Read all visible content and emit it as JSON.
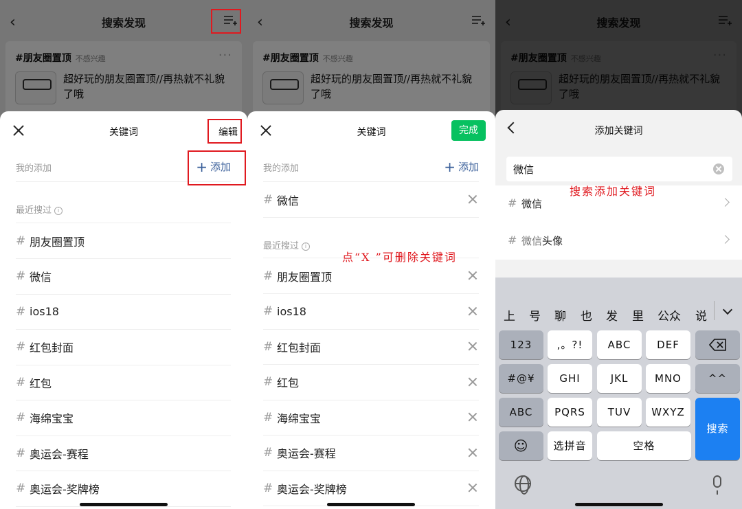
{
  "background_page": {
    "title": "搜索发现",
    "topic_tag": "#朋友圈置顶",
    "not_interested": "不感兴趣",
    "article_title": "超好玩的朋友圈置顶//再热就不礼貌了哦",
    "more": "···"
  },
  "panel1": {
    "sheet_title": "关键词",
    "edit_label": "编辑",
    "my_added_label": "我的添加",
    "add_label": "添加",
    "recent_label": "最近搜过",
    "recent_items": [
      "朋友圈置顶",
      "微信",
      "ios18",
      "红包封面",
      "红包",
      "海绵宝宝",
      "奥运会-赛程",
      "奥运会-奖牌榜"
    ]
  },
  "panel2": {
    "sheet_title": "关键词",
    "done_label": "完成",
    "my_added_label": "我的添加",
    "add_label": "添加",
    "my_added_items": [
      "微信"
    ],
    "recent_label": "最近搜过",
    "recent_items": [
      "朋友圈置顶",
      "ios18",
      "红包封面",
      "红包",
      "海绵宝宝",
      "奥运会-赛程",
      "奥运会-奖牌榜"
    ],
    "annotation": "点“X  ”可删除关键词"
  },
  "panel3": {
    "title": "添加关键词",
    "search_value": "微信",
    "annotation": "搜索添加关键词",
    "suggestions": [
      {
        "match": "微信",
        "rest": ""
      },
      {
        "match": "微信",
        "rest": "头像"
      }
    ],
    "candidates": [
      "上",
      "号",
      "聊",
      "也",
      "发",
      "里",
      "公众",
      "说"
    ],
    "keys": {
      "k123": "123",
      "punct": ",。?!",
      "abc": "ABC",
      "def": "DEF",
      "symbols": "#@¥",
      "ghi": "GHI",
      "jkl": "JKL",
      "mno": "MNO",
      "tone": "^^",
      "abc_switch": "ABC",
      "pqrs": "PQRS",
      "tuv": "TUV",
      "wxyz": "WXYZ",
      "search": "搜索",
      "emoji": "☺",
      "pinyin": "选拼音",
      "space": "空格"
    }
  },
  "colors": {
    "accent_green": "#07c160",
    "link_blue": "#3a5f9a",
    "annotation_red": "#e0191f",
    "keyboard_blue": "#1c80f2"
  }
}
